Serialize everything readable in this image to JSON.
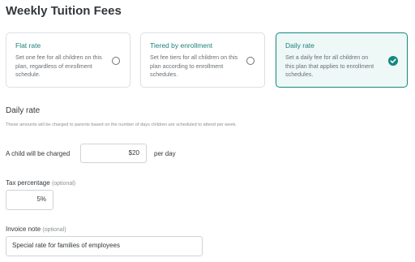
{
  "page": {
    "title": "Weekly Tuition Fees"
  },
  "options": [
    {
      "title": "Flat rate",
      "description": "Set one fee for all children on this plan, regardless of enrollment schedule.",
      "selected": false
    },
    {
      "title": "Tiered by enrollment",
      "description": "Set fee tiers for all children on this plan according to enrollment schedules.",
      "selected": false
    },
    {
      "title": "Daily rate",
      "description": "Set a daily fee for all children on this plan that applies to enrollment schedules.",
      "selected": true
    }
  ],
  "section": {
    "title": "Daily rate",
    "subtitle": "These amounts will be charged to parents based on the number of days children are scheduled to attend per week."
  },
  "charge": {
    "label": "A child will be charged",
    "value": "$20",
    "suffix": "per day"
  },
  "tax": {
    "label": "Tax percentage",
    "optional": "(optional)",
    "value": "5%"
  },
  "invoice": {
    "label": "Invoice note",
    "optional": "(optional)",
    "value": "Special rate for families of employees"
  },
  "colors": {
    "accent": "#13897f",
    "selected_bg": "#eef8f7",
    "border": "#dcdfe3"
  }
}
